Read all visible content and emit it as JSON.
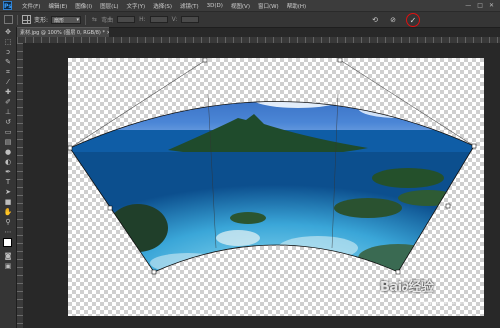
{
  "app": {
    "logo_text": "Ps"
  },
  "menu": {
    "items": [
      "文件(F)",
      "编辑(E)",
      "图像(I)",
      "图层(L)",
      "文字(Y)",
      "选择(S)",
      "滤镜(T)",
      "3D(D)",
      "视图(V)",
      "窗口(W)",
      "帮助(H)"
    ],
    "window_controls": [
      "—",
      "□",
      "✕"
    ]
  },
  "options_bar": {
    "warp_label": "变形:",
    "warp_style": "扇形",
    "bend_label": "弯曲",
    "h_label": "H:",
    "v_label": "V:"
  },
  "document": {
    "tab_title": "素材.jpg @ 100% (图层 0, RGB/8) * ✕"
  },
  "watermark": {
    "text": "Bai∂经验",
    "sub": "jingyan.baidu.com"
  },
  "icons": {
    "cancel": "cancel-icon",
    "commit": "checkmark-icon",
    "reset": "reset-icon"
  },
  "colors": {
    "commit_highlight": "#dd1111",
    "panel": "#353535"
  }
}
